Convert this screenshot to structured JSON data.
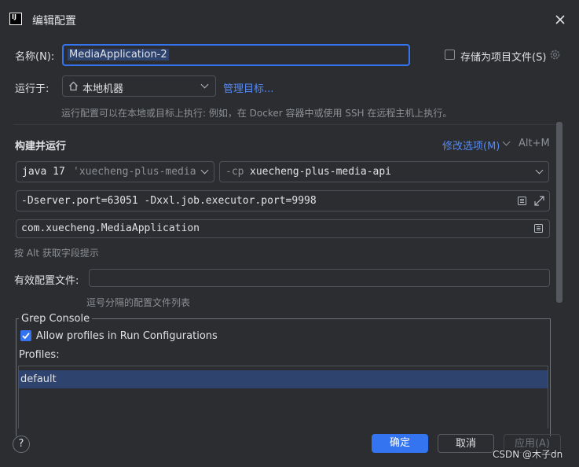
{
  "window": {
    "title": "编辑配置",
    "logo": "IJ"
  },
  "name_row": {
    "label": "名称(N):",
    "value": "MediaApplication-2",
    "store_label": "存储为项目文件(S)"
  },
  "run_on": {
    "label": "运行于:",
    "target": "本地机器",
    "manage_link": "管理目标...",
    "hint": "运行配置可以在本地或目标上执行: 例如，在 Docker 容器中或使用 SSH 在远程主机上执行。"
  },
  "build": {
    "header": "构建并运行",
    "modify_options": "修改选项(M)",
    "shortcut": "Alt+M",
    "jdk": "java 17",
    "jdk_project": "'xuecheng-plus-media",
    "cp_prefix": "-cp",
    "cp_module": "xuecheng-plus-media-api",
    "vm_options": "-Dserver.port=63051 -Dxxl.job.executor.port=9998",
    "main_class": "com.xuecheng.MediaApplication",
    "alt_hint": "按 Alt 获取字段提示"
  },
  "profiles_row": {
    "label": "有效配置文件:",
    "value": "",
    "hint": "逗号分隔的配置文件列表"
  },
  "grep_console": {
    "title": "Grep Console",
    "checkbox_label": "Allow profiles in Run Configurations",
    "checked": true,
    "profiles_label": "Profiles:",
    "items": [
      "default"
    ]
  },
  "footer": {
    "ok": "确定",
    "cancel": "取消",
    "apply": "应用(A)",
    "watermark": "CSDN @木子dn"
  },
  "colors": {
    "accent": "#3574f0",
    "bg": "#2b2d30",
    "border": "#4e5157",
    "selection": "#2e436e"
  }
}
